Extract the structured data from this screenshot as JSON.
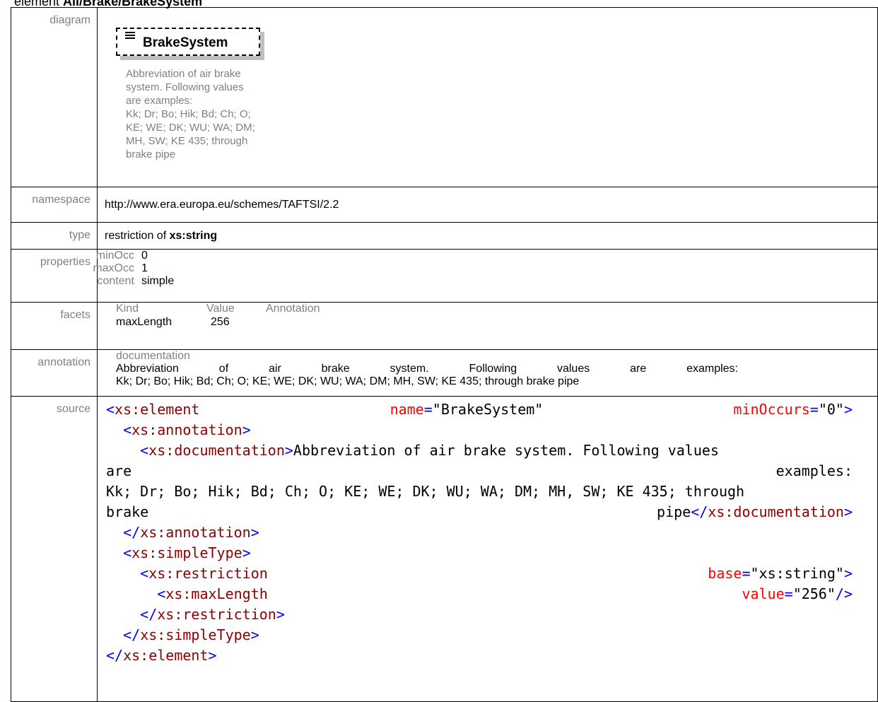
{
  "heading": {
    "prefix": "element ",
    "name": "All/Brake/BrakeSystem"
  },
  "rows": {
    "diagram": {
      "label": "diagram"
    },
    "namespace": {
      "label": "namespace",
      "value": "http://www.era.europa.eu/schemes/TAFTSI/2.2"
    },
    "type": {
      "label": "type",
      "prefix": "restriction of ",
      "value": "xs:string"
    },
    "properties": {
      "label": "properties"
    },
    "facets": {
      "label": "facets"
    },
    "annotation": {
      "label": "annotation"
    },
    "source": {
      "label": "source"
    }
  },
  "diagram": {
    "element_name": "BrakeSystem",
    "doc_text": "Abbreviation of air brake\nsystem. Following values\nare examples:\nKk; Dr; Bo; Hik; Bd; Ch; O;\nKE; WE; DK; WU; WA; DM;\nMH, SW; KE 435; through\nbrake pipe"
  },
  "properties": [
    {
      "key": "minOcc",
      "value": "0"
    },
    {
      "key": "maxOcc",
      "value": "1"
    },
    {
      "key": "content",
      "value": "simple"
    }
  ],
  "facets": {
    "headers": [
      "Kind",
      "Value",
      "Annotation"
    ],
    "rows": [
      {
        "kind": "maxLength",
        "value": "256",
        "annotation": ""
      }
    ]
  },
  "annotation": {
    "label": "documentation",
    "line1_words": [
      "Abbreviation",
      "of",
      "air",
      "brake",
      "system.",
      "Following",
      "values",
      "are",
      "examples:"
    ],
    "line2": "Kk; Dr; Bo; Hik; Bd; Ch; O; KE; WE; DK; WU; WA; DM; MH, SW; KE 435; through brake pipe"
  },
  "source": {
    "l1_open": "<",
    "l1_tag": "xs:element",
    "l1_attr1": "name",
    "l1_val1": "\"BrakeSystem\"",
    "l1_attr2": "minOccurs",
    "l1_val2": "\"0\"",
    "l1_close": ">",
    "l2_open": "<",
    "l2_tag": "xs:annotation",
    "l2_close": ">",
    "l3_open": "<",
    "l3_tag": "xs:documentation",
    "l3_close": ">",
    "l3_text": "Abbreviation of air brake system. Following values",
    "l4_a": "are",
    "l4_b": "examples:",
    "l5_text": "Kk; Dr; Bo; Hik; Bd; Ch; O; KE; WE; DK; WU; WA; DM; MH, SW; KE 435; through",
    "l6_a": "brake",
    "l6_b": "pipe",
    "l6_open": "</",
    "l6_tag": "xs:documentation",
    "l6_close": ">",
    "l7_open": "</",
    "l7_tag": "xs:annotation",
    "l7_close": ">",
    "l8_open": "<",
    "l8_tag": "xs:simpleType",
    "l8_close": ">",
    "l9_open": "<",
    "l9_tag": "xs:restriction",
    "l9_attr": "base",
    "l9_val": "\"xs:string\"",
    "l9_close": ">",
    "l10_open": "<",
    "l10_tag": "xs:maxLength",
    "l10_attr": "value",
    "l10_val": "\"256\"",
    "l10_close": "/>",
    "l11_open": "</",
    "l11_tag": "xs:restriction",
    "l11_close": ">",
    "l12_open": "</",
    "l12_tag": "xs:simpleType",
    "l12_close": ">",
    "l13_open": "</",
    "l13_tag": "xs:element",
    "l13_close": ">"
  }
}
